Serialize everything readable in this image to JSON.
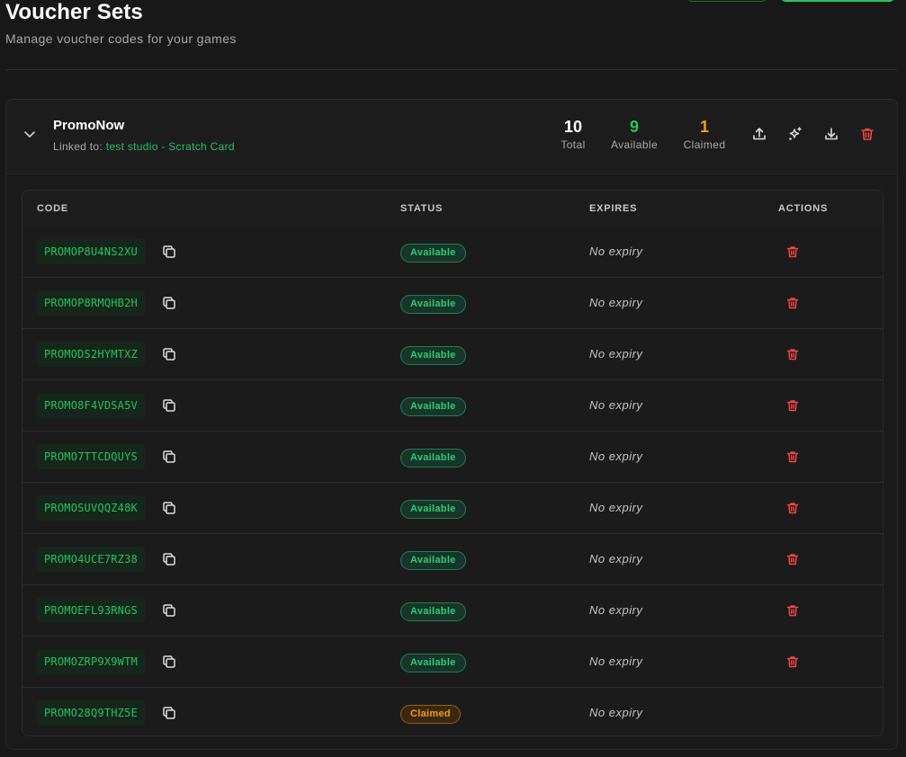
{
  "page": {
    "title": "Voucher Sets",
    "subtitle": "Manage voucher codes for your games"
  },
  "set": {
    "name": "PromoNow",
    "linked_prefix": "Linked to:",
    "linked_target": "test studio - Scratch Card",
    "stats": {
      "total_value": "10",
      "total_label": "Total",
      "available_value": "9",
      "available_label": "Available",
      "claimed_value": "1",
      "claimed_label": "Claimed"
    },
    "actions": [
      "upload-icon",
      "sparkles-icon",
      "download-icon",
      "trash-icon"
    ]
  },
  "table": {
    "headers": {
      "code": "CODE",
      "status": "STATUS",
      "expires": "EXPIRES",
      "actions": "ACTIONS"
    },
    "rows": [
      {
        "code": "PROMOP8U4NS2XU",
        "status": "Available",
        "expires": "No expiry",
        "deletable": true
      },
      {
        "code": "PROMOP8RMQHB2H",
        "status": "Available",
        "expires": "No expiry",
        "deletable": true
      },
      {
        "code": "PROMODS2HYMTXZ",
        "status": "Available",
        "expires": "No expiry",
        "deletable": true
      },
      {
        "code": "PROMO8F4VDSA5V",
        "status": "Available",
        "expires": "No expiry",
        "deletable": true
      },
      {
        "code": "PROMO7TTCDQUYS",
        "status": "Available",
        "expires": "No expiry",
        "deletable": true
      },
      {
        "code": "PROMOSUVQQZ48K",
        "status": "Available",
        "expires": "No expiry",
        "deletable": true
      },
      {
        "code": "PROMO4UCE7RZ38",
        "status": "Available",
        "expires": "No expiry",
        "deletable": true
      },
      {
        "code": "PROMOEFL93RNGS",
        "status": "Available",
        "expires": "No expiry",
        "deletable": true
      },
      {
        "code": "PROMOZRP9X9WTM",
        "status": "Available",
        "expires": "No expiry",
        "deletable": true
      },
      {
        "code": "PROMO28Q9THZ5E",
        "status": "Claimed",
        "expires": "No expiry",
        "deletable": false
      }
    ]
  },
  "colors": {
    "accent": "#22c55e",
    "claimed": "#f59e0b",
    "danger": "#ef4444",
    "background": "#181818"
  }
}
